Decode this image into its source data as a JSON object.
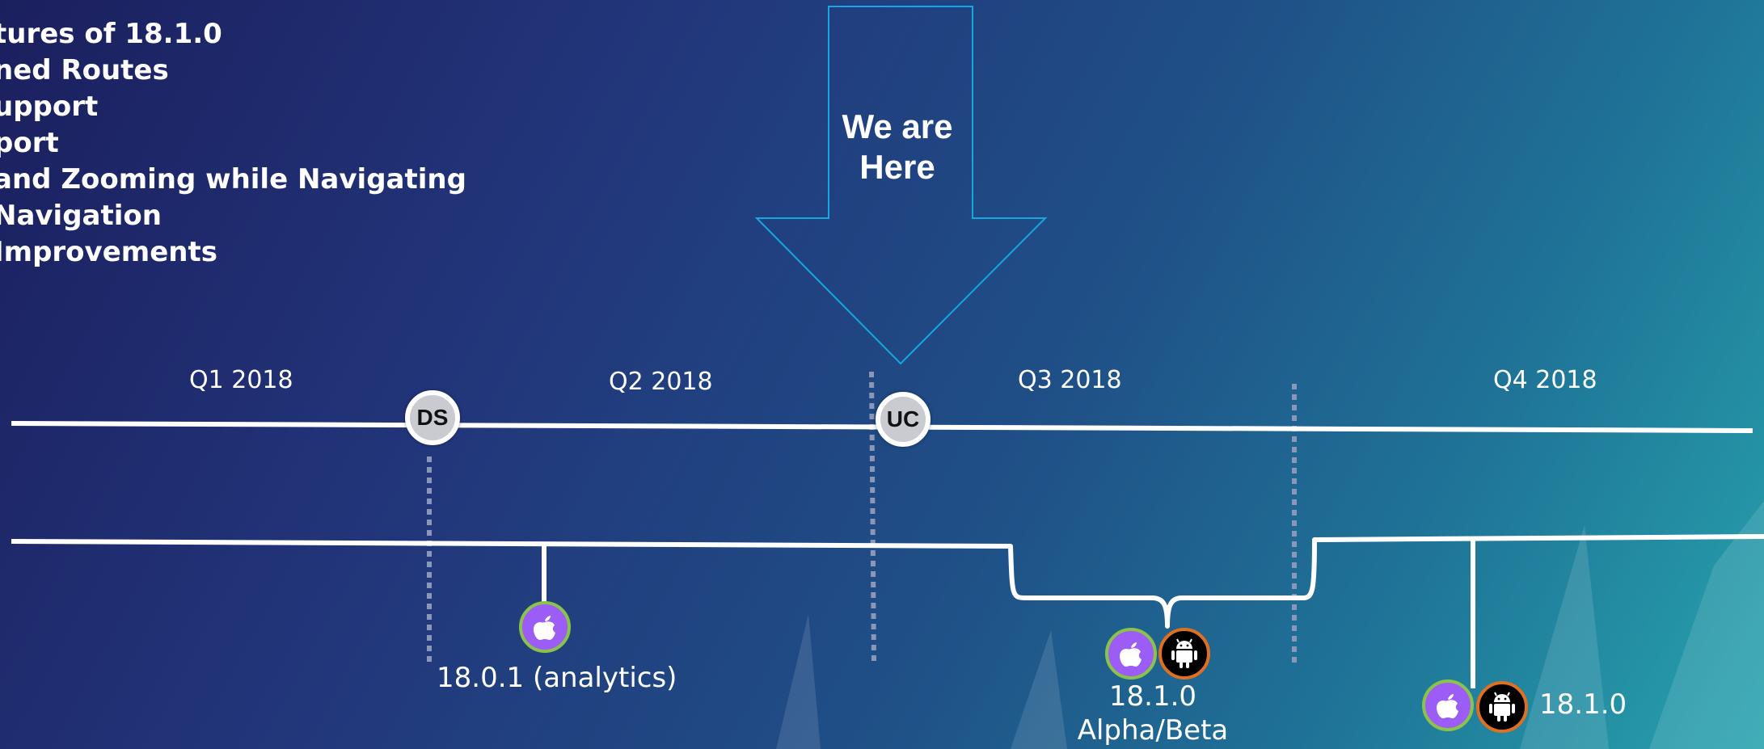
{
  "features": [
    "tures of 18.1.0",
    "ned Routes",
    "upport",
    "port",
    " and Zooming while Navigating",
    "Navigation",
    " Improvements"
  ],
  "callout": {
    "line1": "We are",
    "line2": "Here"
  },
  "quarters": [
    "Q1 2018",
    "Q2 2018",
    "Q3 2018",
    "Q4 2018"
  ],
  "milestones": {
    "ds": "DS",
    "uc": "UC"
  },
  "releases": {
    "r1": "18.0.1 (analytics)",
    "r2_line1": "18.1.0",
    "r2_line2": "Alpha/Beta",
    "r3": "18.1.0"
  },
  "colors": {
    "arrow_stroke": "#17a6e0",
    "ios_badge": "#9c5cf6",
    "ios_ring": "#8bc34a",
    "android_badge": "#000000",
    "android_ring": "#e07020",
    "divider": "#8a97b8"
  },
  "icons": [
    "apple-icon",
    "android-icon"
  ]
}
